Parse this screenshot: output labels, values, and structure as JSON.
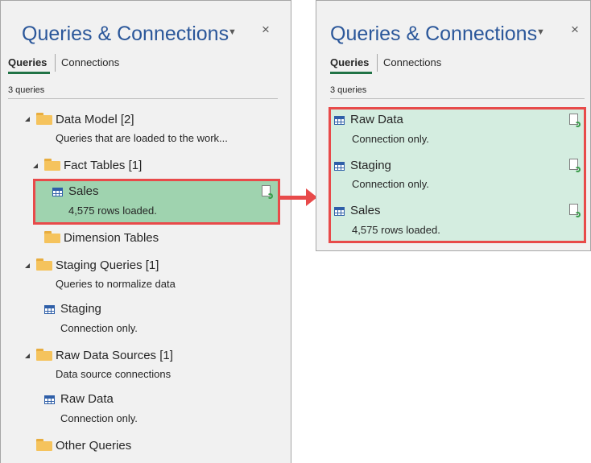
{
  "left_panel": {
    "title": "Queries & Connections",
    "tabs": [
      "Queries",
      "Connections"
    ],
    "count": "3 queries",
    "tree": {
      "data_model": {
        "label": "Data Model [2]",
        "desc": "Queries that are loaded to the work..."
      },
      "fact_tables": {
        "label": "Fact Tables [1]"
      },
      "sales": {
        "label": "Sales",
        "status": "4,575 rows loaded."
      },
      "dimension_tables": {
        "label": "Dimension Tables"
      },
      "staging_queries": {
        "label": "Staging Queries [1]",
        "desc": "Queries to normalize data"
      },
      "staging": {
        "label": "Staging",
        "status": "Connection only."
      },
      "raw_data_sources": {
        "label": "Raw Data Sources [1]",
        "desc": "Data source connections"
      },
      "raw_data": {
        "label": "Raw Data",
        "status": "Connection only."
      },
      "other_queries": {
        "label": "Other Queries"
      }
    }
  },
  "right_panel": {
    "title": "Queries & Connections",
    "tabs": [
      "Queries",
      "Connections"
    ],
    "count": "3 queries",
    "items": [
      {
        "label": "Raw Data",
        "status": "Connection only."
      },
      {
        "label": "Staging",
        "status": "Connection only."
      },
      {
        "label": "Sales",
        "status": "4,575 rows loaded."
      }
    ]
  },
  "icons": {
    "dropdown": "▼",
    "close": "×"
  },
  "colors": {
    "title_blue": "#2b579a",
    "tab_underline": "#217346",
    "highlight_green": "#9fd3af",
    "highlight_light": "#d4ede0",
    "annotation_red": "#e84a4a",
    "folder_yellow": "#f5c35d"
  }
}
